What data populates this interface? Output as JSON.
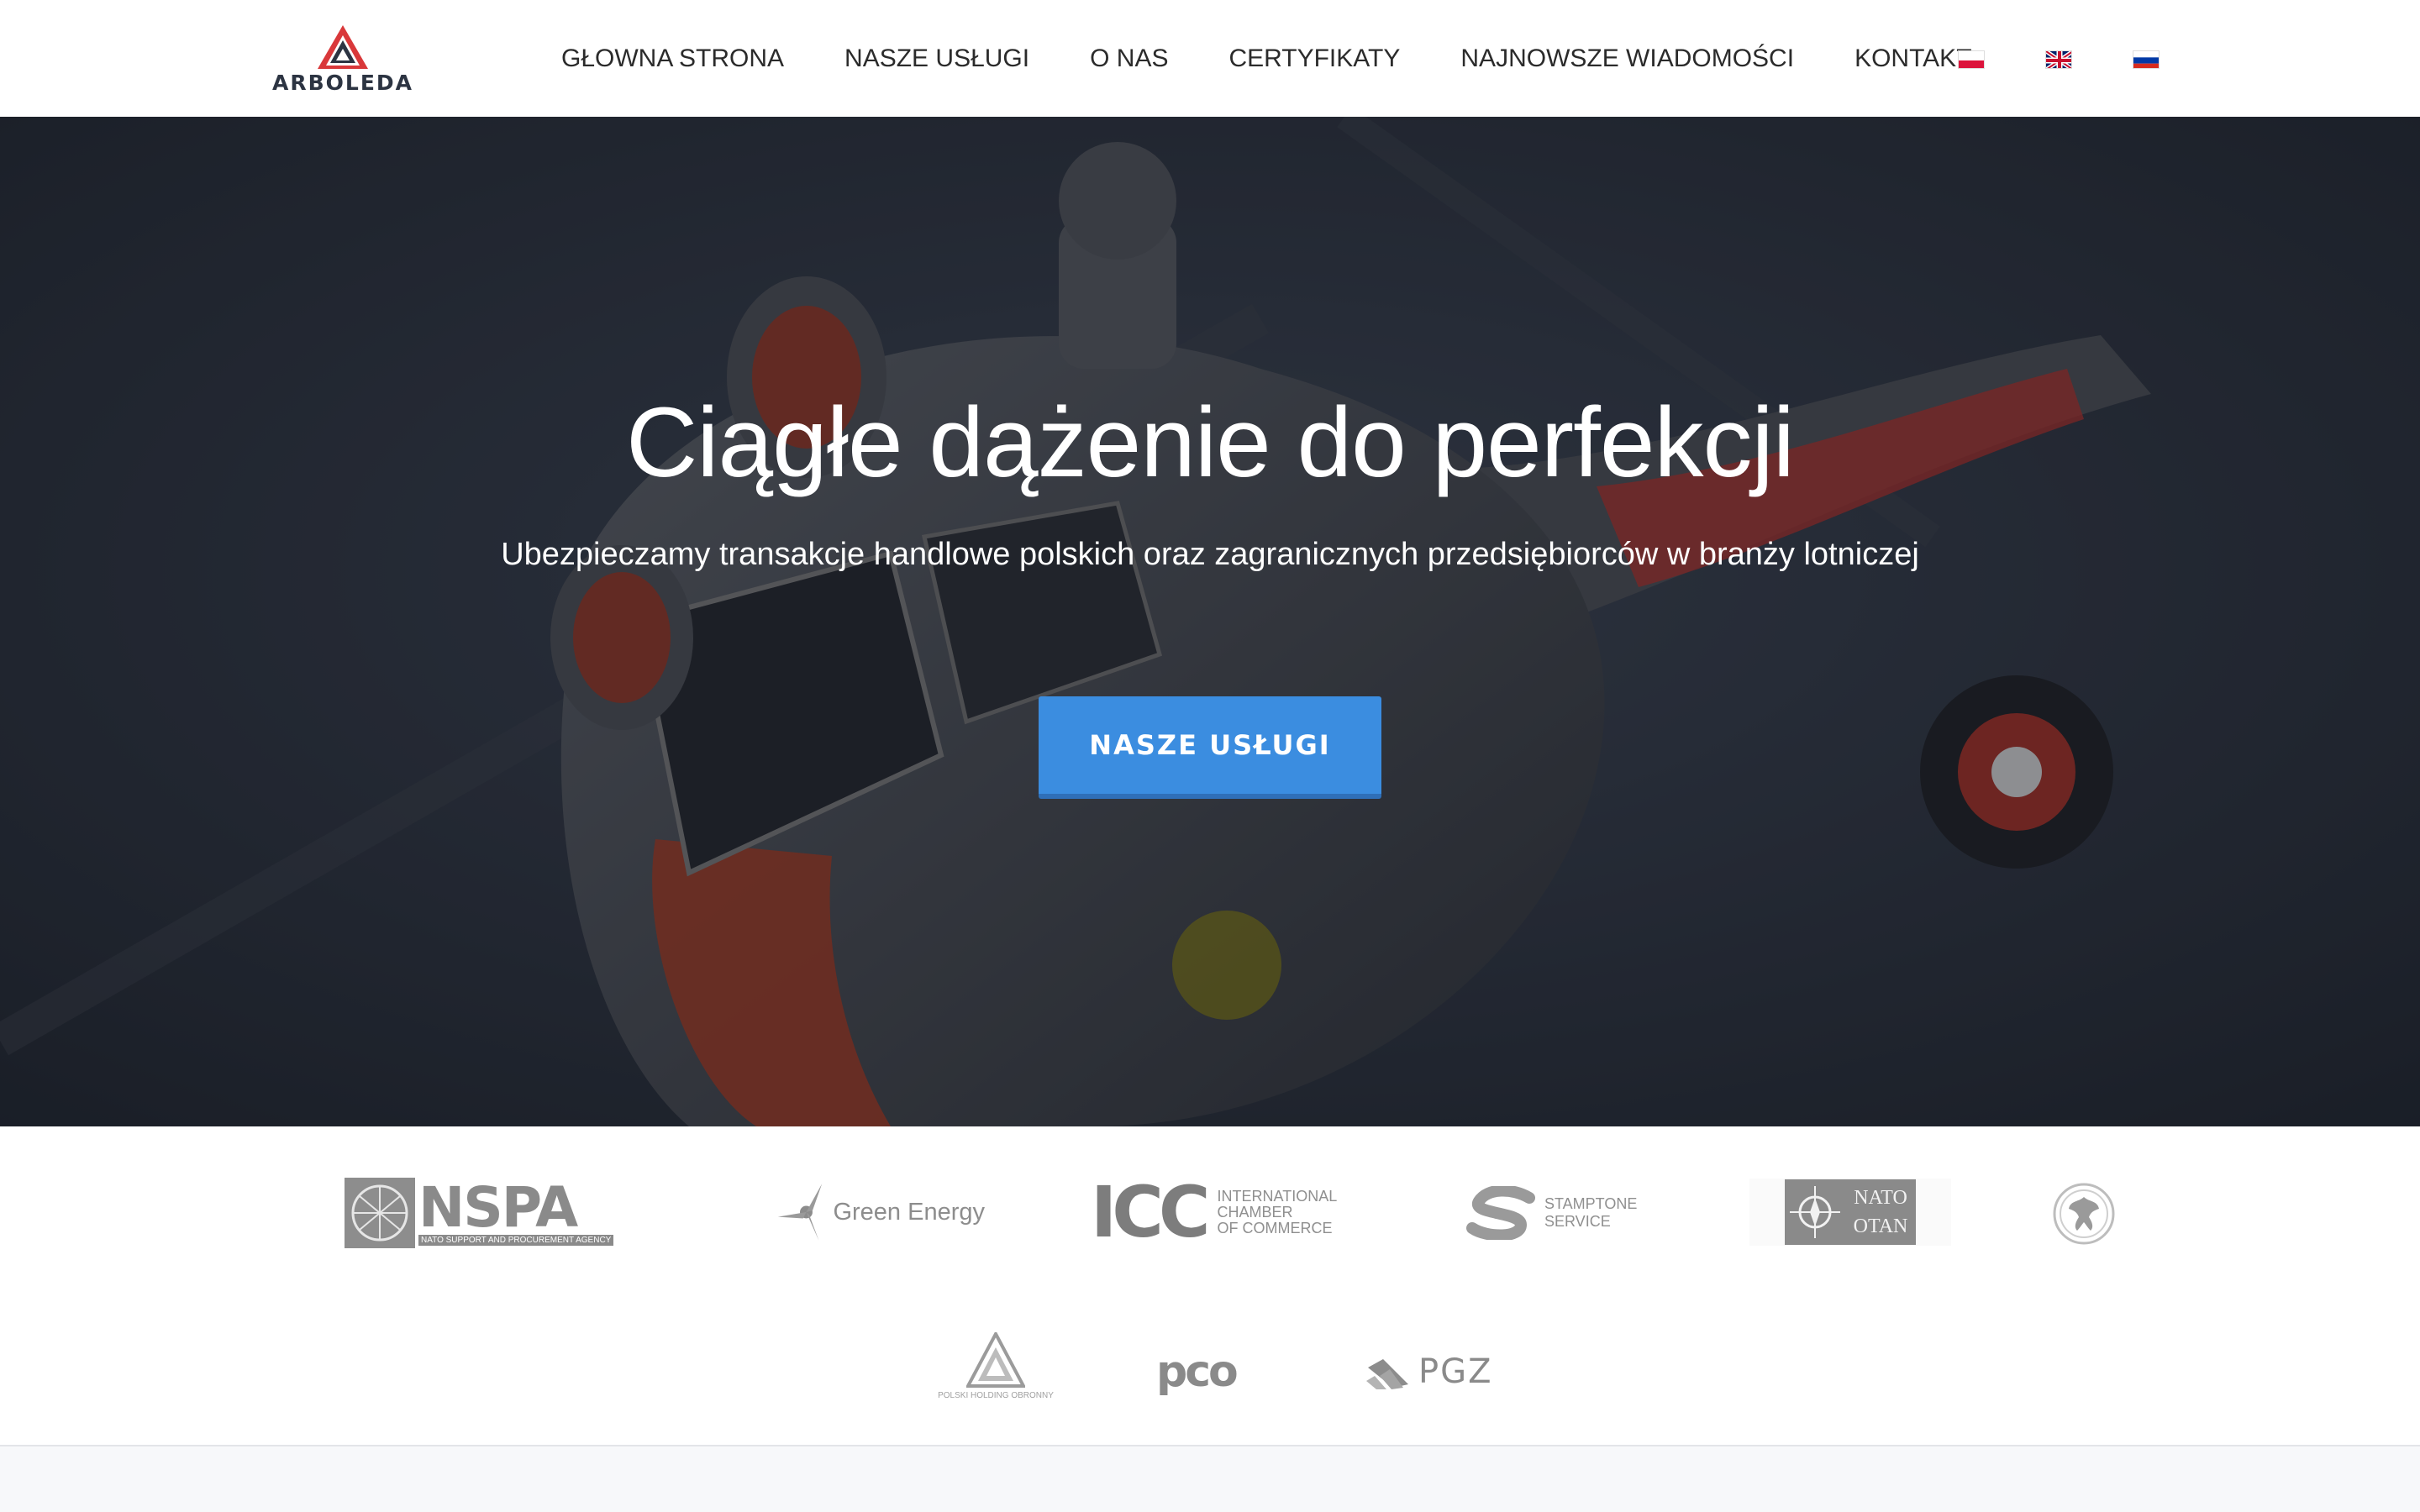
{
  "header": {
    "logo_text": "ARBOLEDA",
    "nav": [
      {
        "label": "GŁOWNA STRONA"
      },
      {
        "label": "NASZE USŁUGI"
      },
      {
        "label": "O NAS"
      },
      {
        "label": "CERTYFIKATY"
      },
      {
        "label": "NAJNOWSZE WIADOMOŚCI"
      },
      {
        "label": "KONTAKT"
      }
    ],
    "languages": [
      "pl-flag-icon",
      "uk-flag-icon",
      "ru-flag-icon"
    ]
  },
  "hero": {
    "title": "Ciągłe dążenie do perfekcji",
    "subtitle": "Ubezpieczamy transakcje handlowe polskich oraz zagranicznych przedsiębiorców w branży lotniczej",
    "cta_label": "NASZE USŁUGI"
  },
  "partners": {
    "nspa": {
      "name": "NSPA",
      "caption": "NATO SUPPORT AND PROCUREMENT AGENCY"
    },
    "green_energy": {
      "name": "Green Energy"
    },
    "icc": {
      "name": "ICC",
      "line1": "INTERNATIONAL",
      "line2": "CHAMBER",
      "line3": "OF COMMERCE"
    },
    "stamptone": {
      "line1": "STAMPTONE",
      "line2": "SERVICE"
    },
    "nato": {
      "line1": "NATO",
      "line2": "OTAN"
    },
    "pho": {
      "caption": "POLSKI HOLDING OBRONNY"
    },
    "pco": {
      "name": "pco"
    },
    "pgz": {
      "name": "PGZ"
    }
  },
  "colors": {
    "accent": "#3b8de0",
    "header_bg": "#ffffff",
    "nav_text": "#2b2b2b",
    "logo_red": "#d9383a",
    "logo_navy": "#2c3442"
  }
}
